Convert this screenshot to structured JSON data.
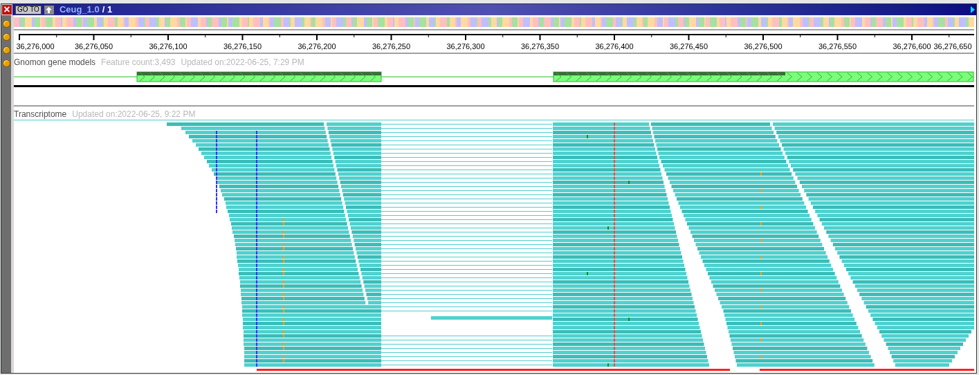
{
  "window": {
    "close_label": "×",
    "goto_label": "GO TO",
    "assembly": "Ceug_1.0",
    "sequence": "/ 1"
  },
  "ruler": {
    "labels": [
      "36,276,000",
      "36,276,050",
      "36,276,100",
      "36,276,150",
      "36,276,200",
      "36,276,250",
      "36,276,300",
      "36,276,350",
      "36,276,400",
      "36,276,450",
      "36,276,500",
      "36,276,550",
      "36,276,600",
      "36,276,650"
    ]
  },
  "tracks": [
    {
      "kind": "genes",
      "name": "Gnomon gene models",
      "details": [
        "Feature count:3,493",
        "Updated on:2022-06-25, 7:29 PM"
      ]
    },
    {
      "kind": "reads",
      "name": "Transcriptome",
      "details": [
        "Updated on:2022-06-25, 9:22 PM"
      ]
    }
  ]
}
